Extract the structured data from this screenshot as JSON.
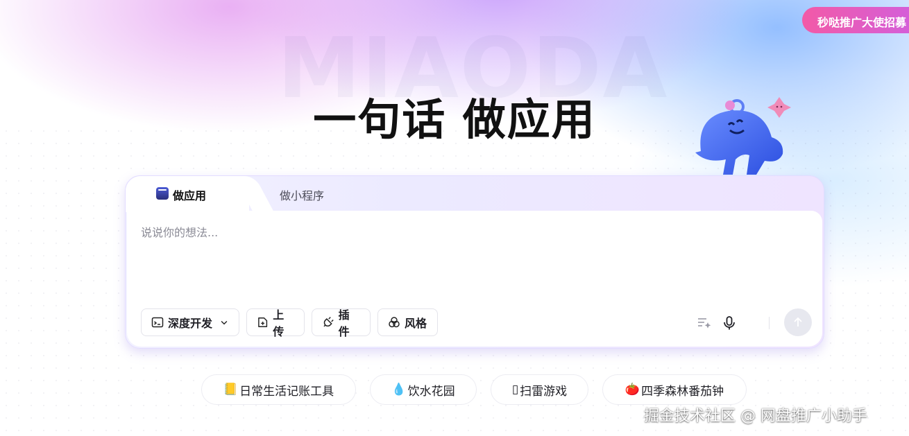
{
  "brand_watermark": "MIAODA",
  "headline": "一句话 做应用",
  "promo_button": "秒哒推广大使招募",
  "composer": {
    "tabs": [
      {
        "label": "做应用",
        "active": true
      },
      {
        "label": "做小程序",
        "active": false
      }
    ],
    "placeholder": "说说你的想法...",
    "tools": {
      "deep_dev": "深度开发",
      "upload": "上传",
      "plugin": "插件",
      "style": "风格"
    },
    "icons": {
      "deep_dev": "terminal-window-icon",
      "deep_dev_caret": "chevron-down-icon",
      "upload": "file-plus-icon",
      "plugin": "plug-icon",
      "style": "three-circles-icon",
      "optimize": "list-sparkle-icon",
      "mic": "microphone-icon",
      "send": "arrow-up-icon"
    }
  },
  "suggestions": [
    {
      "icon": "📒",
      "label": "日常生活记账工具"
    },
    {
      "icon": "💧",
      "label": "饮水花园"
    },
    {
      "icon": "▯",
      "label": "扫雷游戏"
    },
    {
      "icon": "🍅",
      "label": "四季森林番茄钟"
    }
  ],
  "page_watermark": "掘金技术社区 @ 网盘推广小助手",
  "colors": {
    "promo_gradient_start": "#f25aa7",
    "promo_gradient_end": "#d05fe0",
    "send_button_bg": "#e7e8ef"
  }
}
